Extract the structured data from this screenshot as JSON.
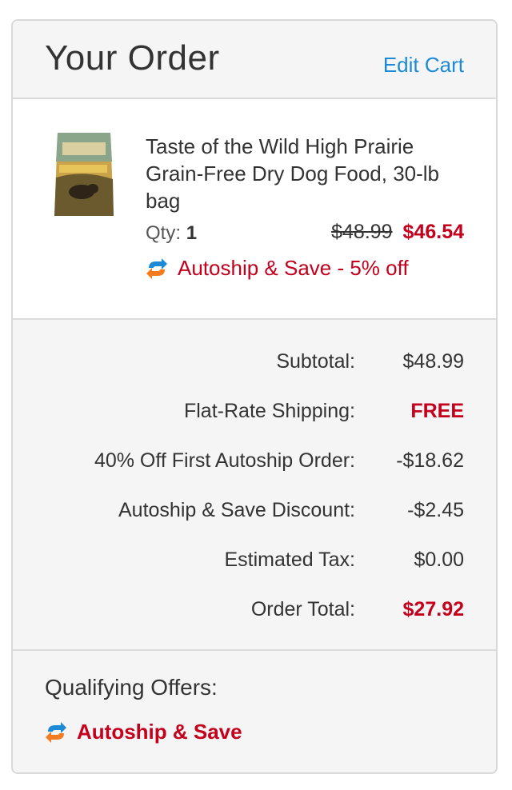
{
  "header": {
    "title": "Your Order",
    "edit_label": "Edit Cart"
  },
  "item": {
    "image_icon": "dog-food-bag-image",
    "name": "Taste of the Wild High Prairie Grain-Free Dry Dog Food, 30-lb bag",
    "qty_label": "Qty:",
    "qty_value": "1",
    "old_price": "$48.99",
    "new_price": "$46.54",
    "autoship_icon": "autoship-refresh-icon",
    "autoship_text": "Autoship & Save - 5% off"
  },
  "summary": [
    {
      "label": "Subtotal:",
      "value": "$48.99"
    },
    {
      "label": "Flat-Rate Shipping:",
      "value": "FREE"
    },
    {
      "label": "40% Off First Autoship Order:",
      "value": "-$18.62"
    },
    {
      "label": "Autoship & Save Discount:",
      "value": "-$2.45"
    },
    {
      "label": "Estimated Tax:",
      "value": "$0.00"
    },
    {
      "label": "Order Total:",
      "value": "$27.92"
    }
  ],
  "offers": {
    "title": "Qualifying Offers:",
    "items": [
      {
        "icon": "autoship-refresh-icon",
        "label": "Autoship & Save"
      }
    ]
  },
  "colors": {
    "accent_red": "#c4001d",
    "link_blue": "#1c8ad6",
    "autoship_blue": "#1c8ad6",
    "autoship_orange": "#f47b20"
  }
}
